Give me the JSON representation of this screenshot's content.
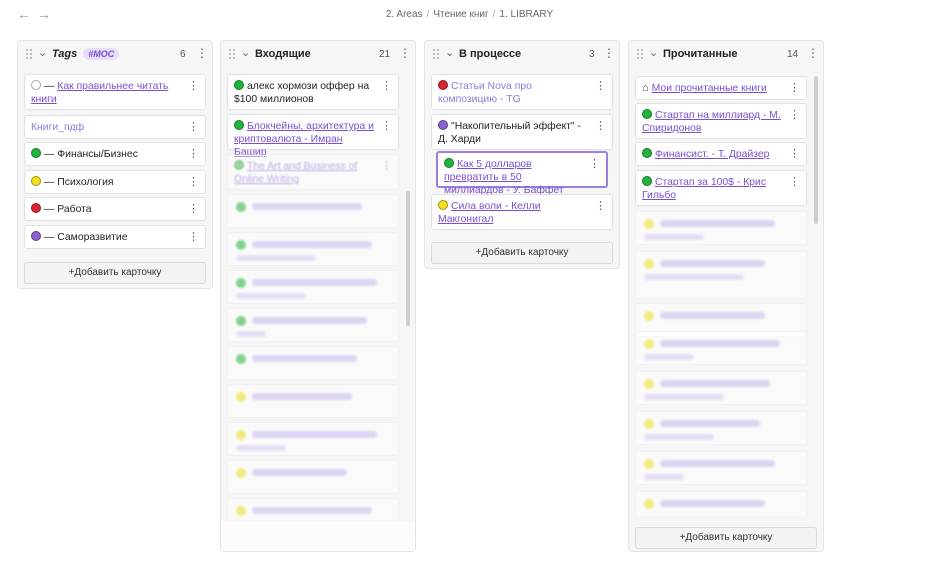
{
  "nav": {
    "back_glyph": "←",
    "forward_glyph": "→"
  },
  "breadcrumb": [
    "2. Areas",
    "Чтение книг",
    "1. LIBRARY"
  ],
  "lanes": [
    {
      "title": "Tags",
      "tag": "#MOC",
      "count": "6",
      "add_label": "+Добавить карточку",
      "cards": [
        {
          "dot": "outline",
          "prefix": "— ",
          "link": "Как правильнее читать книги",
          "text": ""
        },
        {
          "dot": "",
          "prefix": "",
          "link": "",
          "text": "Книги_пдф"
        },
        {
          "dot": "green",
          "prefix": "",
          "link": "",
          "text": "— Финансы/Бизнес"
        },
        {
          "dot": "yellow",
          "prefix": "",
          "link": "",
          "text": "— Психология"
        },
        {
          "dot": "red",
          "prefix": "",
          "link": "",
          "text": "— Работа"
        },
        {
          "dot": "purple",
          "prefix": "",
          "link": "",
          "text": "— Саморазвитие"
        }
      ]
    },
    {
      "title": "Входящие",
      "count": "21",
      "add_label": "+Добавить карточку",
      "cards": [
        {
          "dot": "green",
          "link": "",
          "text": "алекс хормози оффер на $100 миллионов"
        },
        {
          "dot": "green",
          "link": "Блокчейны, архитектура и криптовалюта - Имран Башир",
          "text": ""
        },
        {
          "dot": "green",
          "link": "The Art and Business of Online Writing",
          "text": ""
        }
      ]
    },
    {
      "title": "В процессе",
      "count": "3",
      "add_label": "+Добавить карточку",
      "cards": [
        {
          "dot": "red",
          "link": "",
          "text": "Статьи Nova про композицию - TG"
        },
        {
          "dot": "purple",
          "link": "",
          "text": "\"Накопительный эффект\" - Д. Харди"
        },
        {
          "dot": "green",
          "link": "Как 5 долларов превратить в 50 миллиардов - У. Баффет",
          "text": ""
        },
        {
          "dot": "yellow",
          "link": "Сила воли - Келли Макгонигал",
          "text": ""
        }
      ]
    },
    {
      "title": "Прочитанные",
      "count": "14",
      "add_label": "+Добавить карточку",
      "cards": [
        {
          "dot": "home",
          "link": "Мои прочитанные книги",
          "text": ""
        },
        {
          "dot": "green",
          "link": "Стартап на миллиард - М. Спиридонов",
          "text": ""
        },
        {
          "dot": "green",
          "link": "Финансист. - Т. Драйзер",
          "text": ""
        },
        {
          "dot": "green",
          "link": "Стартап за 100$ - Крис Гильбо",
          "text": ""
        }
      ]
    }
  ],
  "colors": {
    "green": "#1fb53a",
    "yellow": "#f2e21c",
    "red": "#d9262c",
    "purple": "#8a63cf",
    "accent": "#7a4fd1"
  }
}
